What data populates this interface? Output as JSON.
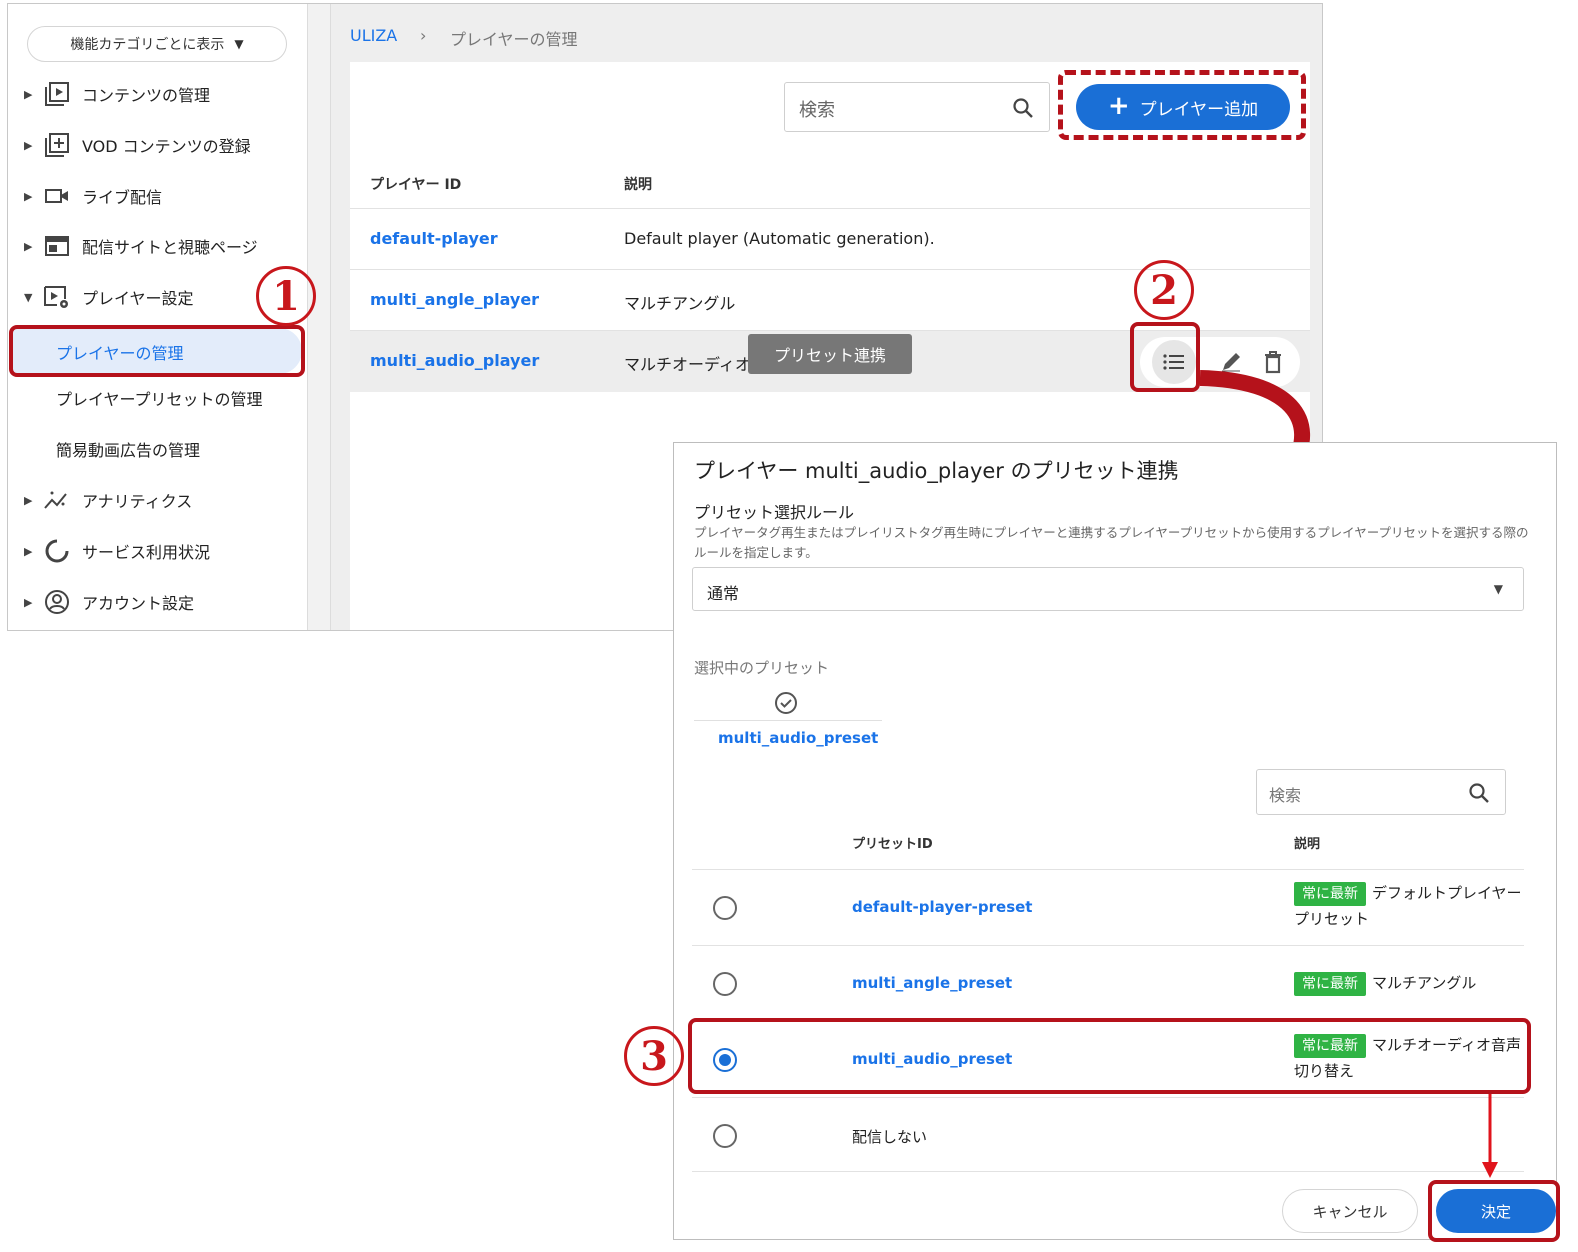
{
  "sidebar": {
    "category_button": "機能カテゴリごとに表示",
    "items": [
      {
        "label": "コンテンツの管理",
        "icon": "play-square-icon"
      },
      {
        "label": "VOD コンテンツの登録",
        "icon": "add-square-icon"
      },
      {
        "label": "ライブ配信",
        "icon": "video-camera-icon"
      },
      {
        "label": "配信サイトと視聴ページ",
        "icon": "web-layout-icon"
      },
      {
        "label": "プレイヤー設定",
        "icon": "player-settings-icon"
      },
      {
        "label": "アナリティクス",
        "icon": "analytics-icon"
      },
      {
        "label": "サービス利用状況",
        "icon": "donut-chart-icon"
      },
      {
        "label": "アカウント設定",
        "icon": "account-circle-icon"
      }
    ],
    "subitems": [
      "プレイヤーの管理",
      "プレイヤープリセットの管理",
      "簡易動画広告の管理"
    ]
  },
  "breadcrumb": {
    "root": "ULIZA",
    "separator": "›",
    "current": "プレイヤーの管理"
  },
  "toolbar": {
    "search_placeholder": "検索",
    "add_button": "プレイヤー追加"
  },
  "table": {
    "headers": [
      "プレイヤー ID",
      "説明"
    ],
    "rows": [
      {
        "id": "default-player",
        "desc": "Default player (Automatic generation)."
      },
      {
        "id": "multi_angle_player",
        "desc": "マルチアングル"
      },
      {
        "id": "multi_audio_player",
        "desc": "マルチオーディオ用"
      }
    ],
    "tooltip": "プリセット連携"
  },
  "annotations": {
    "one": "1",
    "two": "2",
    "three": "3"
  },
  "dialog": {
    "title": "プレイヤー multi_audio_player のプリセット連携",
    "rule_label": "プリセット選択ルール",
    "rule_help": "プレイヤータグ再生またはプレイリストタグ再生時にプレイヤーと連携するプレイヤープリセットから使用するプレイヤープリセットを選択する際のルールを指定します。",
    "rule_value": "通常",
    "selected_label": "選択中のプリセット",
    "selected_preset": "multi_audio_preset",
    "search_placeholder": "検索",
    "headers": [
      "プリセットID",
      "説明"
    ],
    "badge": "常に最新",
    "rows": [
      {
        "id": "default-player-preset",
        "desc": "デフォルトプレイヤープリセット",
        "selected": false
      },
      {
        "id": "multi_angle_preset",
        "desc": "マルチアングル",
        "selected": false
      },
      {
        "id": "multi_audio_preset",
        "desc": "マルチオーディオ音声切り替え",
        "selected": true
      },
      {
        "id": "配信しない",
        "desc": "",
        "selected": false
      }
    ],
    "cancel": "キャンセル",
    "ok": "決定"
  },
  "colors": {
    "accent": "#1a6fd6",
    "annotation": "#b5121b",
    "badge": "#2fb344"
  }
}
